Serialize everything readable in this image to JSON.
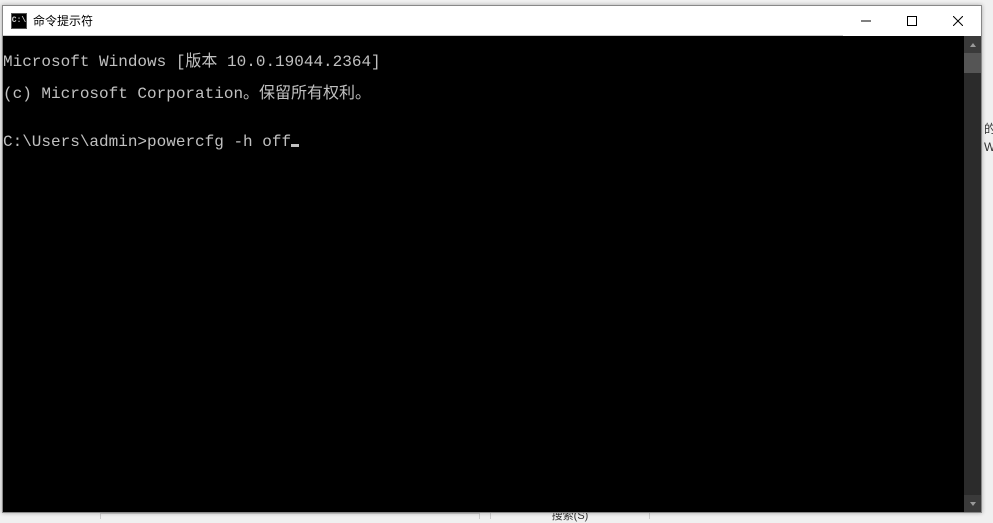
{
  "window": {
    "title": "命令提示符",
    "icon_text": "C:\\"
  },
  "terminal": {
    "line1": "Microsoft Windows [版本 10.0.19044.2364]",
    "line2": "(c) Microsoft Corporation。保留所有权利。",
    "blank": "",
    "prompt": "C:\\Users\\admin>",
    "command": "powercfg -h off"
  },
  "background": {
    "frag1": "的",
    "frag2": "W",
    "bottom_label": "搜索(S)"
  }
}
